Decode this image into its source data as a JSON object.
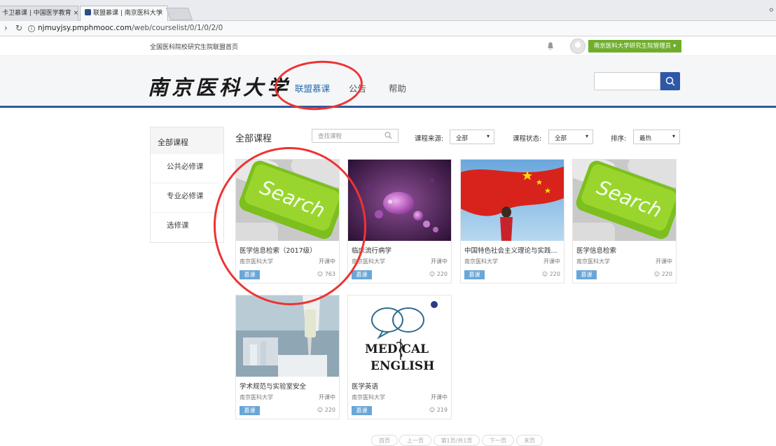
{
  "browser": {
    "tabs": [
      {
        "label": "卡卫慕课 | 中国医学教育 ×",
        "active": false
      },
      {
        "label": "联盟慕课 | 南京医科大学",
        "active": true
      }
    ],
    "tab_close": "×",
    "url_host": "njmuyjsy.pmphmooc.com",
    "url_path": "/web/courselist/0/1/0/2/0"
  },
  "topstrip": {
    "home_link": "全国医科院校研究生院联盟首页",
    "admin_label": "南京医科大学研究生院管理员 ▾"
  },
  "header": {
    "logo_text": "南京医科大学",
    "nav": [
      "联盟慕课",
      "公告",
      "帮助"
    ]
  },
  "sidebar": {
    "head": "全部课程",
    "items": [
      "公共必修课",
      "专业必修课",
      "选修课"
    ]
  },
  "filters": {
    "title": "全部课程",
    "search_placeholder": "查找课程",
    "source_label": "课程来源:",
    "source_value": "全部",
    "status_label": "课程状态:",
    "status_value": "全部",
    "sort_label": "排序:",
    "sort_value": "最热"
  },
  "courses": [
    {
      "title": "医学信息检索（2017级）",
      "school": "南京医科大学",
      "status": "开课中",
      "badge": "慕课",
      "count": "763",
      "image": "search-key"
    },
    {
      "title": "临床流行病学",
      "school": "南京医科大学",
      "status": "开课中",
      "badge": "慕课",
      "count": "220",
      "image": "virus"
    },
    {
      "title": "中国特色社会主义理论与实践...",
      "school": "南京医科大学",
      "status": "开课中",
      "badge": "慕课",
      "count": "220",
      "image": "flag"
    },
    {
      "title": "医学信息检索",
      "school": "南京医科大学",
      "status": "开课中",
      "badge": "慕课",
      "count": "220",
      "image": "search-key"
    },
    {
      "title": "学术规范与实验室安全",
      "school": "南京医科大学",
      "status": "开课中",
      "badge": "慕课",
      "count": "220",
      "image": "lab"
    },
    {
      "title": "医学英语",
      "school": "南京医科大学",
      "status": "开课中",
      "badge": "慕课",
      "count": "219",
      "image": "medical-english"
    }
  ],
  "image_text": {
    "search_word": "Search",
    "med_line1": "MED  CAL",
    "med_line2": "ENGLISH"
  },
  "pager": [
    "首页",
    "上一页",
    "第1页/共1页",
    "下一页",
    "末页"
  ],
  "colors": {
    "accent_blue": "#2f57a8",
    "admin_green": "#6fae2b",
    "badge_blue": "#6aa6d8",
    "annotation_red": "#e33333"
  }
}
